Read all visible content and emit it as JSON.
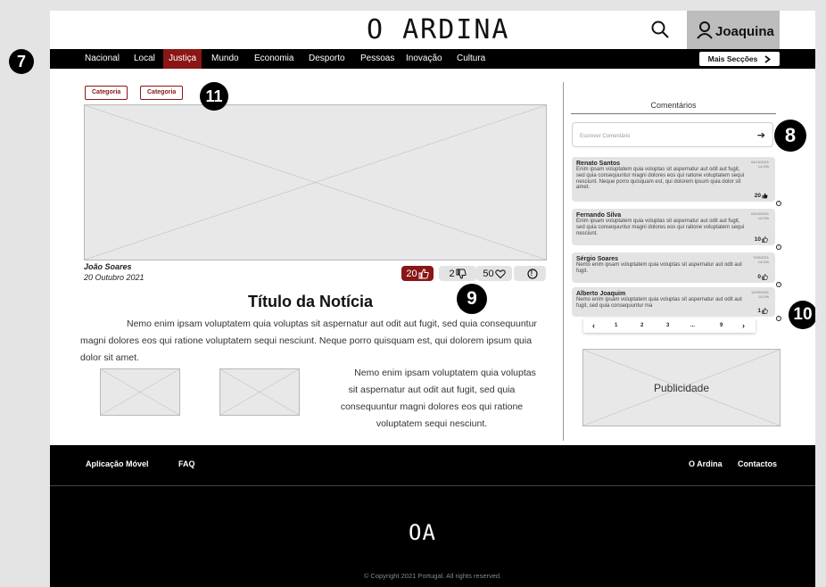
{
  "header": {
    "logo": "O ARDINA",
    "user_name": "Joaquina"
  },
  "nav": {
    "items": [
      "Nacional",
      "Local",
      "Justiça",
      "Mundo",
      "Economia",
      "Desporto",
      "Pessoas",
      "Inovação",
      "Cultura"
    ],
    "active": "Justiça",
    "more_label": "Mais Secções"
  },
  "annotations": [
    "7",
    "8",
    "9",
    "10",
    "11"
  ],
  "article": {
    "categories": [
      "Categoria",
      "Categoria"
    ],
    "author": "João Soares",
    "date": "20 Outubro 2021",
    "reactions": {
      "likes": "20",
      "dislikes": "2",
      "hearts": "50",
      "report": "!"
    },
    "title": "Título da Notícia",
    "paragraph1": "Nemo enim ipsam voluptatem quia voluptas sit aspernatur aut odit aut fugit, sed quia consequuntur magni dolores eos qui ratione voluptatem sequi nesciunt. Neque porro quisquam est, qui dolorem ipsum quia dolor sit amet.",
    "paragraph2": "Nemo enim ipsam voluptatem quia voluptas sit aspernatur aut odit aut fugit, sed quia consequuntur magni dolores eos qui ratione voluptatem sequi nesciunt."
  },
  "comments": {
    "title": "Comentários",
    "input_placeholder": "Escrever Comentário",
    "list": [
      {
        "name": "Renato Santos",
        "date": "04/10/2021",
        "time": "14:29h",
        "text": "Enim ipsam voluptatem quia voluptas sit aspernatur aut odit aut fugit, sed quia consequuntur magni dolores eos qui ratione voluptatem sequi nesciunt. Neque porro quisquam est, qui dolorem ipsum quia dolor sit amet.",
        "likes": "20"
      },
      {
        "name": "Fernando Silva",
        "date": "03/10/2021",
        "time": "14:29h",
        "text": "Enim ipsam voluptatem quia voluptas sit aspernatur aut odit aut fugit, sed quia consequuntur magni dolores eos qui ratione voluptatem sequi nesciunt.",
        "likes": "10"
      },
      {
        "name": "Sérgio Soares",
        "date": "7/09/2021",
        "time": "14:29h",
        "text": "Nemo enim ipsam voluptatem quia voluptas sit aspernatur aut odit aut fugit.",
        "likes": "0"
      },
      {
        "name": "Alberto Joaquim",
        "date": "12/09/2021",
        "time": "14:29h",
        "text": "Nemo enim ipsam voluptatem quia voluptas sit aspernatur aut odit aut fugit, sed quia consequuntur ma",
        "likes": "1"
      }
    ],
    "pagination": [
      "‹",
      "1",
      "2",
      "3",
      "...",
      "9",
      "›"
    ]
  },
  "ad_label": "Publicidade",
  "footer": {
    "links_left": [
      "Aplicação Móvel",
      "FAQ"
    ],
    "links_right": [
      "O Ardina",
      "Contactos"
    ],
    "logo": "OA",
    "copyright": "© Copyright 2021 Portugal. All rights reserved."
  },
  "colors": {
    "accent": "#8a1616",
    "nav_bg": "#000000",
    "placeholder": "#e8e8e8"
  }
}
